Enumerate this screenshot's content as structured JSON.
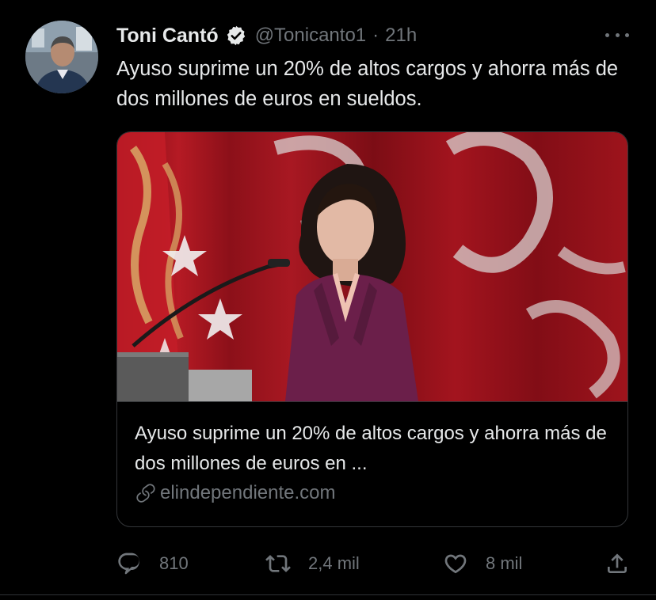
{
  "author": {
    "name": "Toni Cantó",
    "handle": "@Tonicanto1",
    "separator": "·",
    "time": "21h"
  },
  "tweet_text": "Ayuso suprime un 20% de altos cargos y ahorra más de dos millones de euros en sueldos.",
  "link_card": {
    "title": "Ayuso suprime un 20% de altos cargos y ahorra más de dos millones de euros en ...",
    "domain": "elindependiente.com"
  },
  "actions": {
    "reply_count": "810",
    "retweet_count": "2,4 mil",
    "like_count": "8 mil"
  },
  "icons": {
    "verified": "verified-badge-icon",
    "more": "more-options-icon",
    "link": "link-icon",
    "reply": "reply-icon",
    "retweet": "retweet-icon",
    "like": "heart-icon",
    "share": "share-icon"
  },
  "colors": {
    "background": "#000000",
    "text": "#e7e9ea",
    "secondary_text": "#71767b",
    "border": "#333639"
  }
}
